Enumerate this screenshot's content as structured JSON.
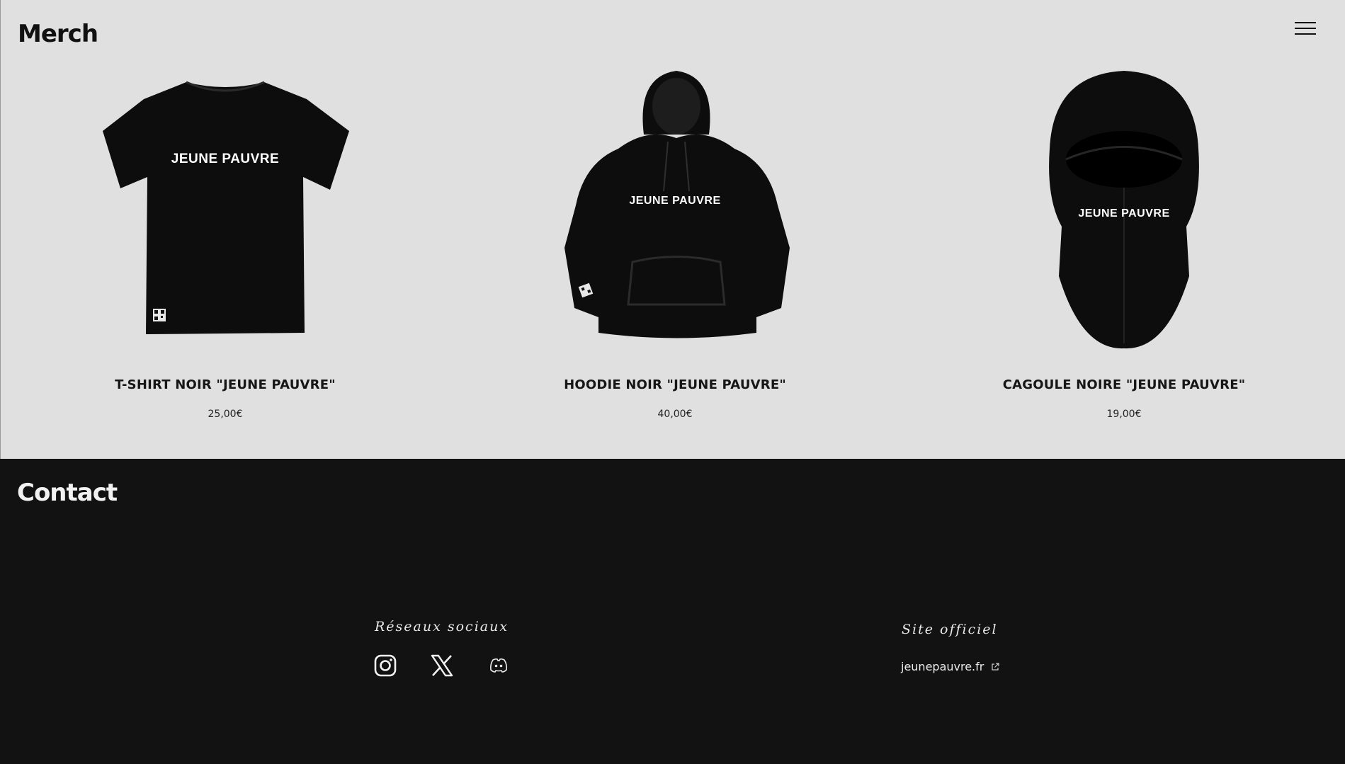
{
  "merch": {
    "title": "Merch",
    "menu_icon": "hamburger-menu-icon",
    "products": [
      {
        "name": "T-SHIRT NOIR \"JEUNE PAUVRE\"",
        "price": "25,00€",
        "print": "JEUNE PAUVRE",
        "image": "black-tshirt"
      },
      {
        "name": "HOODIE NOIR \"JEUNE PAUVRE\"",
        "price": "40,00€",
        "print": "JEUNE PAUVRE",
        "image": "black-hoodie"
      },
      {
        "name": "CAGOULE NOIRE \"JEUNE PAUVRE\"",
        "price": "19,00€",
        "print": "JEUNE PAUVRE",
        "image": "black-balaclava"
      }
    ]
  },
  "contact": {
    "title": "Contact",
    "socials_label": "Réseaux sociaux",
    "socials": [
      {
        "icon": "instagram-icon"
      },
      {
        "icon": "x-twitter-icon"
      },
      {
        "icon": "discord-icon"
      }
    ],
    "site_label": "Site officiel",
    "site_link": "jeunepauvre.fr",
    "site_link_icon": "external-link-icon"
  },
  "colors": {
    "merch_bg": "#e0e0e0",
    "contact_bg": "#121212",
    "garment": "#0d0d0d"
  }
}
